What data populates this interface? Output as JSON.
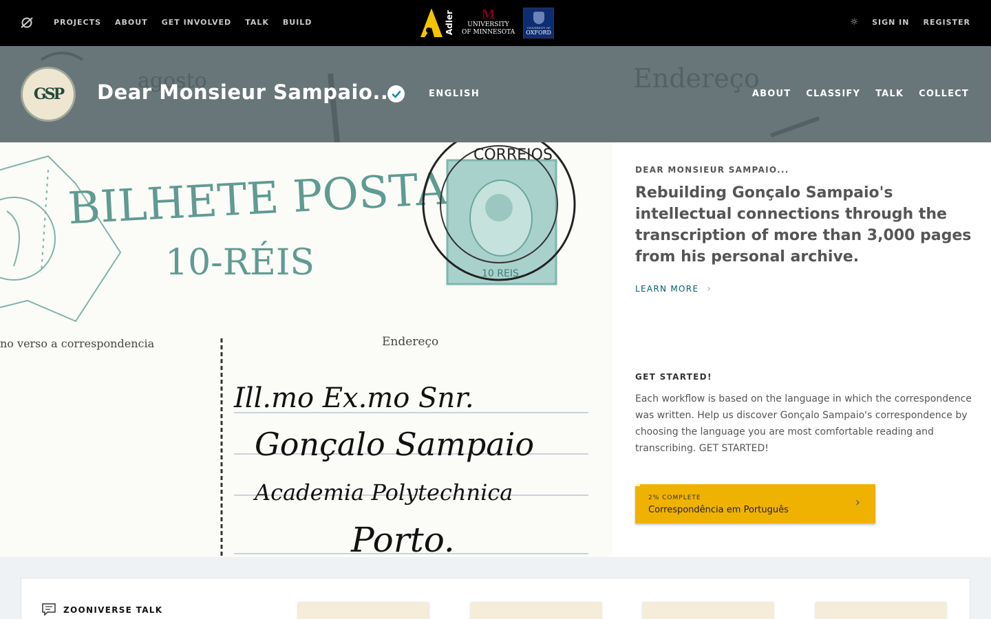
{
  "topnav": {
    "items": [
      "PROJECTS",
      "ABOUT",
      "GET INVOLVED",
      "TALK",
      "BUILD"
    ],
    "partners": {
      "adler": "Adler",
      "umn_line1": "UNIVERSITY",
      "umn_line2": "OF MINNESOTA",
      "oxford_small": "UNIVERSITY OF",
      "oxford": "OXFORD"
    },
    "sign_in": "SIGN IN",
    "register": "REGISTER",
    "theme_icon": "sun-icon"
  },
  "project": {
    "title": "Dear Monsieur Sampaio...",
    "avatar_monogram": "GSP",
    "language": "ENGLISH",
    "nav": [
      "ABOUT",
      "CLASSIFY",
      "TALK",
      "COLLECT"
    ]
  },
  "hero": {
    "postcard": {
      "header": "BILHETE POSTAL",
      "value": "10-RÉIS",
      "verso": "no verso a correspondencia",
      "address_label": "Endereço",
      "hand_lines": [
        "Ill.mo Ex.mo Snr.",
        "Gonçalo Sampaio",
        "Academia Polytechnica",
        "Porto."
      ],
      "stamp_text": "CORREIOS",
      "stamp_value": "10 REIS"
    },
    "eyebrow": "DEAR MONSIEUR SAMPAIO...",
    "tagline": "Rebuilding Gonçalo Sampaio's intellectual connections through the transcription of more than 3,000 pages from his personal archive.",
    "learn_more": "LEARN MORE",
    "get_started_title": "GET STARTED!",
    "get_started_text": "Each workflow is based on the language in which the correspondence was written. Help us discover Gonçalo Sampaio's correspondence by choosing the language you are most comfortable reading and transcribing. GET STARTED!",
    "workflow": {
      "percent_label": "2% COMPLETE",
      "progress": 0.02,
      "name": "Correspondência em Português",
      "color": "#f0b200"
    }
  },
  "talk": {
    "title": "ZOONIVERSE TALK"
  },
  "colors": {
    "topbar": "#000000",
    "header": "#68767a",
    "accent_teal": "#005d69",
    "workflow_yellow": "#f0b200"
  }
}
